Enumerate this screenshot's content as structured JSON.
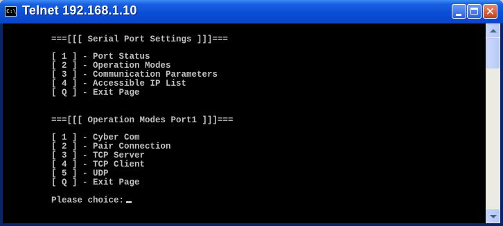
{
  "window": {
    "title": "Telnet 192.168.1.10",
    "icon_text": "C:\\"
  },
  "console": {
    "lines": [
      "===[[[ Serial Port Settings ]]]===",
      "[ 1 ] - Port Status",
      "[ 2 ] - Operation Modes",
      "[ 3 ] - Communication Parameters",
      "[ 4 ] - Accessible IP List",
      "[ Q ] - Exit Page",
      "===[[[ Operation Modes Port1 ]]]===",
      "[ 1 ] - Cyber Com",
      "[ 2 ] - Pair Connection",
      "[ 3 ] - TCP Server",
      "[ 4 ] - TCP Client",
      "[ 5 ] - UDP",
      "[ Q ] - Exit Page",
      "Please choice:"
    ]
  },
  "colors": {
    "titlebar": "#0a4ed6",
    "console_bg": "#000000",
    "console_text": "#c0c0c0"
  }
}
